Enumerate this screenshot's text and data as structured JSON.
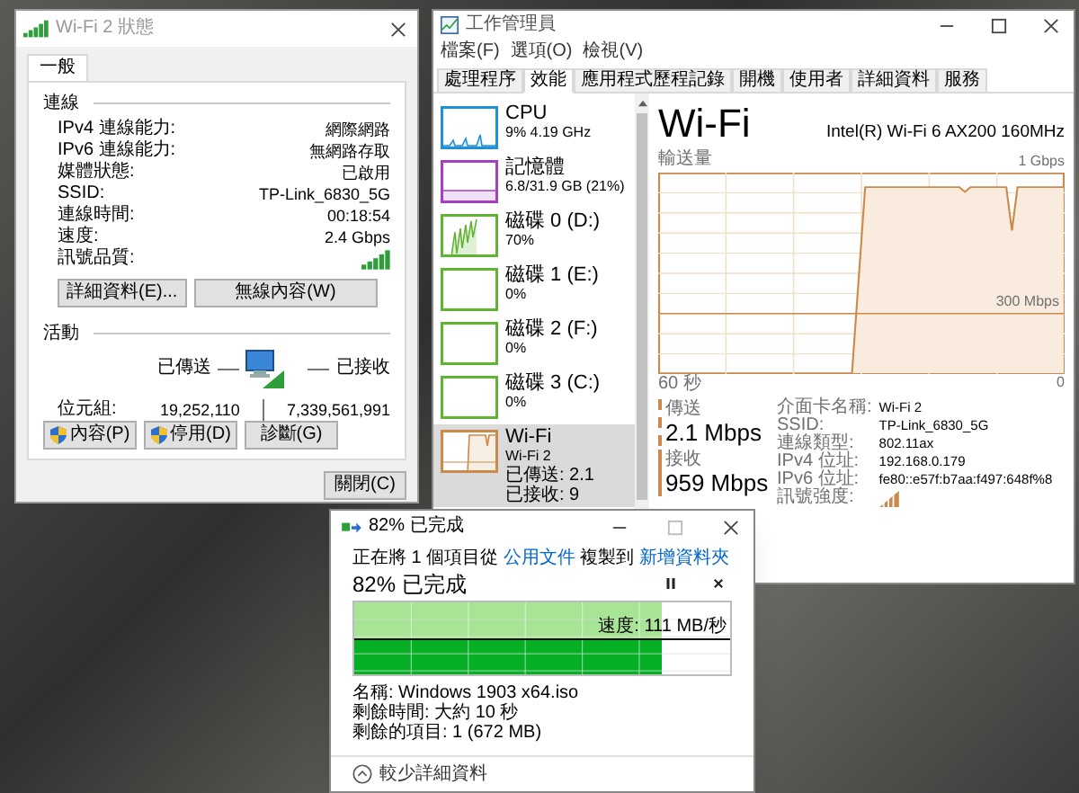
{
  "wifi_status_window": {
    "title": "Wi-Fi 2 狀態",
    "tabs": [
      {
        "label": "一般",
        "selected": true
      }
    ],
    "connection": {
      "heading": "連線",
      "rows": [
        {
          "kind": "text",
          "label": "IPv4 連線能力:",
          "value": "網際網路"
        },
        {
          "kind": "text",
          "label": "IPv6 連線能力:",
          "value": "無網路存取"
        },
        {
          "kind": "text",
          "label": "媒體狀態:",
          "value": "已啟用"
        },
        {
          "kind": "text",
          "label": "SSID:",
          "value": "TP-Link_6830_5G"
        },
        {
          "kind": "text",
          "label": "連線時間:",
          "value": "00:18:54"
        },
        {
          "kind": "text",
          "label": "速度:",
          "value": "2.4 Gbps"
        },
        {
          "kind": "signal",
          "label": "訊號品質:"
        }
      ],
      "buttons": [
        "詳細資料(E)...",
        "無線內容(W)"
      ]
    },
    "activity": {
      "heading": "活動",
      "sent_label": "已傳送",
      "received_label": "已接收",
      "bytes_label": "位元組:",
      "bytes_sent": "19,252,110",
      "bytes_received": "7,339,561,991",
      "buttons": [
        {
          "label": "內容(P)",
          "shield": true
        },
        {
          "label": "停用(D)",
          "shield": true
        },
        {
          "label": "診斷(G)",
          "shield": false
        }
      ]
    },
    "close_button": "關閉(C)"
  },
  "task_manager": {
    "title": "工作管理員",
    "menu": [
      "檔案(F)",
      "選項(O)",
      "檢視(V)"
    ],
    "tabs": [
      {
        "label": "處理程序",
        "selected": false
      },
      {
        "label": "效能",
        "selected": true
      },
      {
        "label": "應用程式歷程記錄",
        "selected": false
      },
      {
        "label": "開機",
        "selected": false
      },
      {
        "label": "使用者",
        "selected": false
      },
      {
        "label": "詳細資料",
        "selected": false
      },
      {
        "label": "服務",
        "selected": false
      }
    ],
    "sidebar": [
      {
        "kind": "cpu",
        "name": "CPU",
        "details": [
          "9% 4.19 GHz"
        ],
        "color": "#1f8fd6",
        "active": true,
        "selected": false
      },
      {
        "kind": "memory",
        "name": "記憶體",
        "details": [
          "6.8/31.9 GB (21%)"
        ],
        "color": "#a63fbf",
        "active": true,
        "selected": false
      },
      {
        "kind": "disk",
        "name": "磁碟 0 (D:)",
        "details": [
          "70%"
        ],
        "color": "#5fb532",
        "active": true,
        "selected": false
      },
      {
        "kind": "disk",
        "name": "磁碟 1 (E:)",
        "details": [
          "0%"
        ],
        "color": "#5fb532",
        "active": false,
        "selected": false
      },
      {
        "kind": "disk",
        "name": "磁碟 2 (F:)",
        "details": [
          "0%"
        ],
        "color": "#5fb532",
        "active": false,
        "selected": false
      },
      {
        "kind": "disk",
        "name": "磁碟 3 (C:)",
        "details": [
          "0%"
        ],
        "color": "#5fb532",
        "active": false,
        "selected": false
      },
      {
        "kind": "network",
        "name": "Wi-Fi",
        "details": [
          "Wi-Fi 2",
          "已傳送: 2.1 已接收: 9"
        ],
        "color": "#c98a4b",
        "active": true,
        "selected": true
      }
    ],
    "performance": {
      "title": "Wi-Fi",
      "adapter": "Intel(R) Wi-Fi 6 AX200 160MHz",
      "graph_label": "輸送量",
      "graph_max": "1 Gbps",
      "graph_mark": "300 Mbps",
      "time_start": "60 秒",
      "time_end": "0",
      "send_label": "傳送",
      "send_value": "2.1 Mbps",
      "receive_label": "接收",
      "receive_value": "959 Mbps",
      "details": [
        {
          "kind": "text",
          "label": "介面卡名稱:",
          "value": "Wi-Fi 2"
        },
        {
          "kind": "text",
          "label": "SSID:",
          "value": "TP-Link_6830_5G"
        },
        {
          "kind": "text",
          "label": "連線類型:",
          "value": "802.11ax"
        },
        {
          "kind": "text",
          "label": "IPv4 位址:",
          "value": "192.168.0.179"
        },
        {
          "kind": "text",
          "label": "IPv6 位址:",
          "value": "fe80::e57f:b7aa:f497:648f%8"
        },
        {
          "kind": "signal",
          "label": "訊號強度:"
        }
      ]
    }
  },
  "copy_dialog": {
    "title": "82% 已完成",
    "description": [
      {
        "kind": "text",
        "text": "正在將 1 個項目從"
      },
      {
        "kind": "link",
        "text": "公用文件"
      },
      {
        "kind": "text",
        "text": "複製到"
      },
      {
        "kind": "link",
        "text": "新增資料夾"
      }
    ],
    "heading": "82% 已完成",
    "progress": {
      "level": 0.82,
      "speed": "速度: 111 MB/秒"
    },
    "details": [
      "名稱: Windows 1903 x64.iso",
      "剩餘時間: 大約 10 秒",
      "剩餘的項目: 1 (672 MB)"
    ],
    "footer": "較少詳細資料"
  }
}
